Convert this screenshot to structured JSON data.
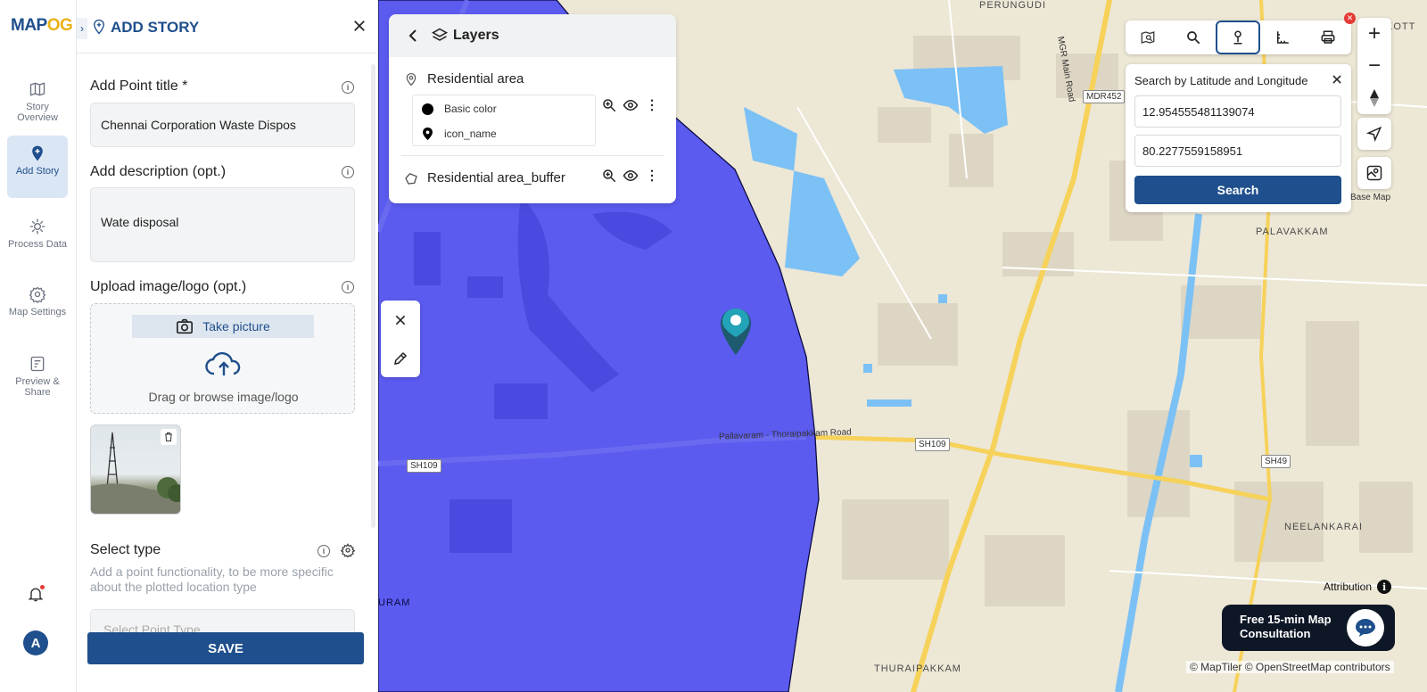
{
  "app": {
    "logo_main": "MAP",
    "logo_accent": "OG"
  },
  "rail": {
    "items": [
      {
        "label": "Story Overview"
      },
      {
        "label": "Add Story"
      },
      {
        "label": "Process Data"
      },
      {
        "label": "Map Settings"
      },
      {
        "label": "Preview & Share"
      }
    ],
    "avatar_letter": "A"
  },
  "panel": {
    "title": "ADD STORY",
    "point_title_label": "Add Point title *",
    "point_title_value": "Chennai Corporation Waste Dispos",
    "description_label": "Add description (opt.)",
    "description_value": "Wate disposal",
    "upload_label": "Upload image/logo (opt.)",
    "take_picture": "Take picture",
    "drag_text": "Drag or browse image/logo",
    "select_type_label": "Select type",
    "select_type_desc": "Add a point functionality, to be more specific about the plotted location type",
    "select_placeholder": "Select Point Type",
    "save_label": "SAVE"
  },
  "layers": {
    "title": "Layers",
    "items": [
      {
        "name": "Residential area",
        "legend": [
          {
            "label": "Basic color"
          },
          {
            "label": "icon_name"
          }
        ]
      },
      {
        "name": "Residential area_buffer"
      }
    ]
  },
  "search": {
    "title": "Search by Latitude and Longitude",
    "latitude": "12.954555481139074",
    "longitude": "80.2277559158951",
    "button": "Search"
  },
  "map": {
    "places": {
      "perungudi": "PERUNGUDI",
      "kott": "KOTT",
      "palavakkam": "PALAVAKKAM",
      "neelankarai": "NEELANKARAI",
      "thuraipakkam": "THURAIPAKKAM",
      "uram": "URAM"
    },
    "roads": {
      "mgr": "MGR Main Road",
      "mdr452": "MDR452",
      "pallavaram": "Pallavaram - Thoraipakkam Road",
      "sh109a": "SH109",
      "sh109b": "SH109",
      "sh49": "SH49"
    },
    "basemap_label": "Base Map",
    "attribution_label": "Attribution",
    "consult_text": "Free 15-min Map Consultation",
    "copyright": "© MapTiler © OpenStreetMap contributors",
    "colors": {
      "buffer": "#5b5bf0",
      "water": "#7cc1f5",
      "land": "#ede7d6",
      "road": "#f6d25a"
    }
  }
}
